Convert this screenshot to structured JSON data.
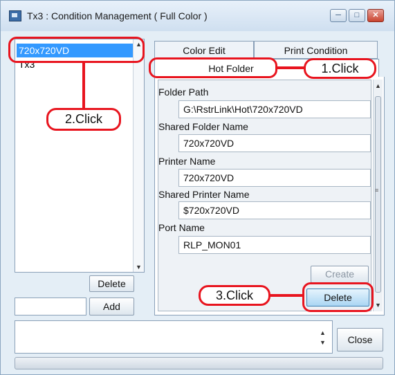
{
  "window": {
    "title": "Tx3 : Condition Management ( Full Color )",
    "controls": [
      "minimize",
      "maximize",
      "close"
    ]
  },
  "left_list": {
    "items": [
      "720x720VD",
      "Tx3"
    ],
    "selected_index": 0,
    "delete_label": "Delete",
    "add_label": "Add",
    "add_input_value": ""
  },
  "tabs": {
    "color_edit": "Color Edit",
    "print_condition": "Print Condition",
    "hot_folder": "Hot Folder",
    "active": "Hot Folder"
  },
  "hot_folder": {
    "folder_path_label": "Folder Path",
    "folder_path_value": "G:\\RstrLink\\Hot\\720x720VD",
    "shared_folder_label": "Shared Folder Name",
    "shared_folder_value": "720x720VD",
    "printer_name_label": "Printer Name",
    "printer_name_value": "720x720VD",
    "shared_printer_label": "Shared Printer Name",
    "shared_printer_value": "$720x720VD",
    "port_name_label": "Port Name",
    "port_name_value": "RLP_MON01",
    "create_label": "Create",
    "delete_label": "Delete"
  },
  "bottom": {
    "message_value": "",
    "close_label": "Close"
  },
  "callouts": {
    "one": "1.Click",
    "two": "2.Click",
    "three": "3.Click"
  },
  "colors": {
    "callout_red": "#e8141e",
    "selection_blue": "#3399ff"
  }
}
